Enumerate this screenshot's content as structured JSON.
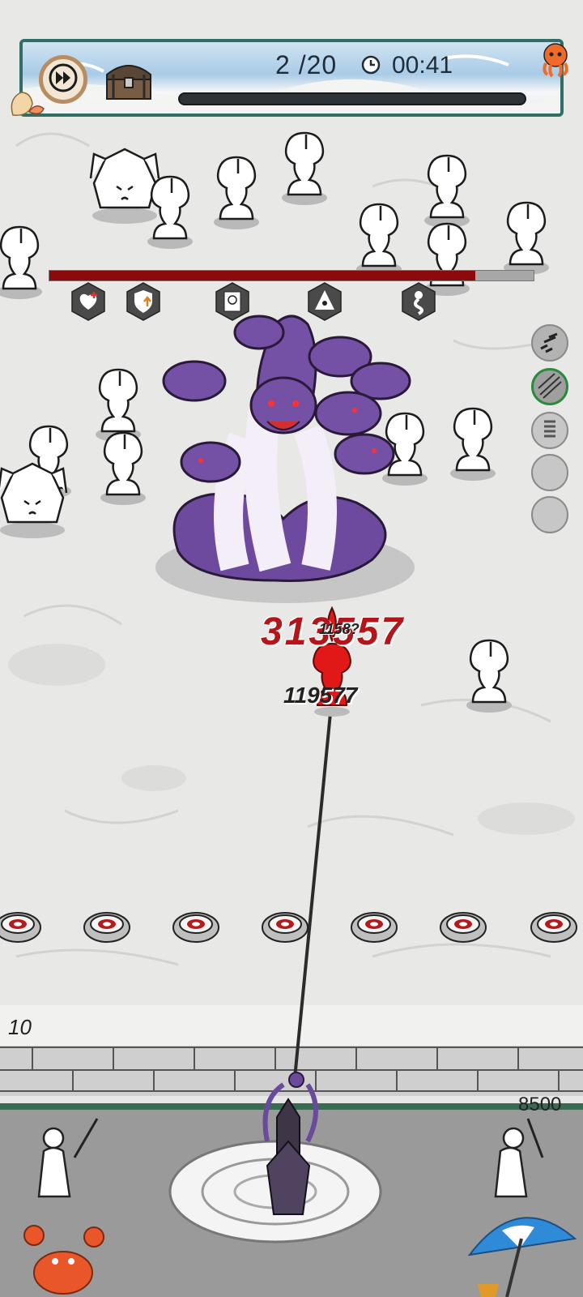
{
  "hud": {
    "wave_text": "2 /20",
    "timer": "00:41",
    "wave_progress": 0.0,
    "fast_forward_icon": "fast-forward-icon",
    "chest_icon": "treasure-chest-icon",
    "clock_icon": "clock-icon",
    "mascot_icon": "octopus-icon"
  },
  "boss": {
    "hp_fraction": 0.88,
    "buffs": [
      "heart-plus-icon",
      "shield-arrow-icon",
      "portrait-card-icon",
      "eye-pyramid-icon",
      "serpent-icon"
    ]
  },
  "skills": [
    "dash-skill-icon",
    "arrow-rain-skill-icon",
    "spring-skill-icon",
    "empty-slot",
    "empty-slot"
  ],
  "damage_numbers": {
    "big": "313557",
    "small": "1158?",
    "mid": "119577"
  },
  "wall": {
    "count": "10",
    "hp": "8500"
  },
  "colors": {
    "hp_bar": "#8c0a0a",
    "frame": "#2f6f66",
    "hydra": "#6e4a9e",
    "damage": "#b4151b"
  }
}
